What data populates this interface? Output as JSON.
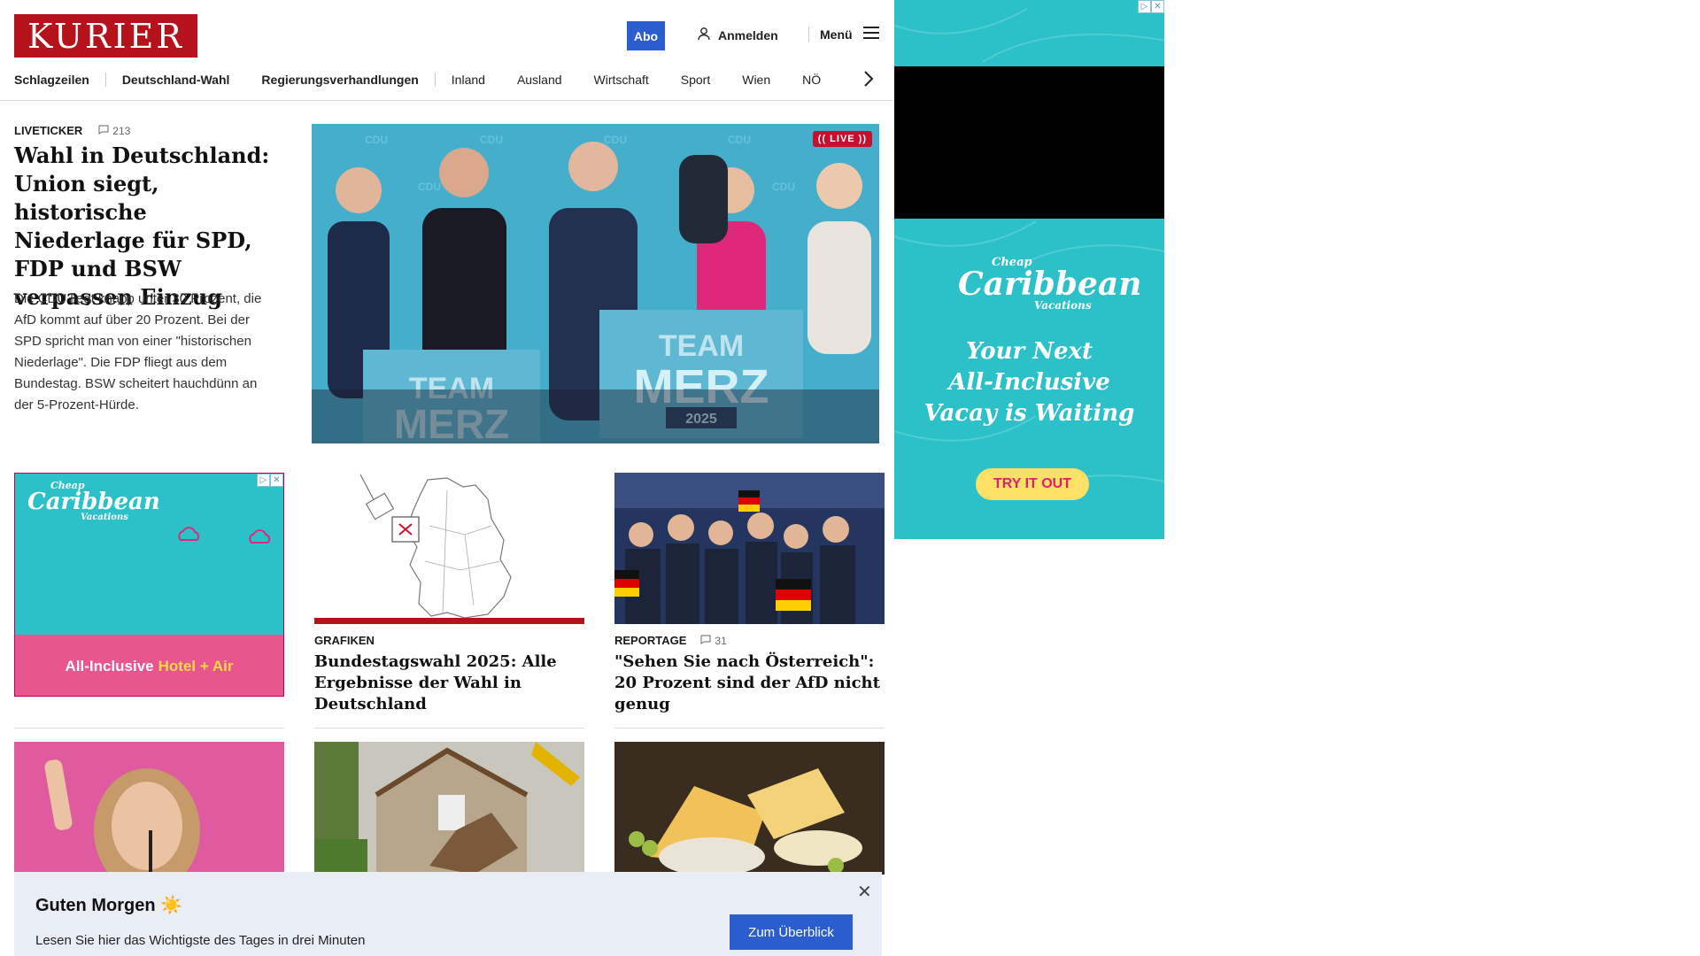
{
  "header": {
    "logo": "KURIER",
    "abo_label": "Abo",
    "login_label": "Anmelden",
    "menu_label": "Menü",
    "nav": [
      "Schlagzeilen",
      "Deutschland-Wahl",
      "Regierungsverhandlungen",
      "Inland",
      "Ausland",
      "Wirtschaft",
      "Sport",
      "Wien",
      "NÖ"
    ]
  },
  "hero": {
    "kicker": "LIVETICKER",
    "comments": "213",
    "title": "Wahl in Deutschland: Union siegt, historische Niederlage für SPD, FDP und BSW verpassen Einzug",
    "teaser": "Die CDU liegt knapp unter 30 Prozent, die AfD kommt auf über 20 Prozent. Bei der SPD spricht man von einer \"historischen Niederlage\". Die FDP fliegt aus dem Bundestag. BSW scheitert hauchdünn an der 5-Prozent-Hürde.",
    "live_label": "(( LIVE ))",
    "image_signs": [
      "TEAM",
      "MERZ",
      "2025",
      "CDU"
    ]
  },
  "ad_small": {
    "brand_top": "Cheap",
    "brand": "Caribbean",
    "brand_sub": "Vacations",
    "offer": "All-Inclusive",
    "offer_accent": "Hotel + Air"
  },
  "cards": [
    {
      "kicker": "GRAFIKEN",
      "comments": "",
      "title": "Bundestagswahl 2025: Alle Ergebnisse der Wahl in Deutschland"
    },
    {
      "kicker": "REPORTAGE",
      "comments": "31",
      "title": "\"Sehen Sie nach Österreich\": 20 Prozent sind der AfD nicht genug"
    }
  ],
  "ad_big": {
    "brand_top": "Cheap",
    "brand": "Caribbean",
    "brand_sub": "Vacations",
    "copy_line1": "Your Next",
    "copy_line2": "All-Inclusive",
    "copy_line3": "Vacay is Waiting",
    "cta": "TRY IT OUT"
  },
  "morning": {
    "title": "Guten Morgen ☀️",
    "subtitle": "Lesen Sie hier das Wichtigste des Tages in drei Minuten",
    "button": "Zum Überblick"
  },
  "colors": {
    "brand_red": "#b5121b",
    "accent_blue": "#2b5dcf",
    "live_red": "#c8102e",
    "ad_teal": "#2cc1c8",
    "ad_pink": "#e8558f"
  }
}
